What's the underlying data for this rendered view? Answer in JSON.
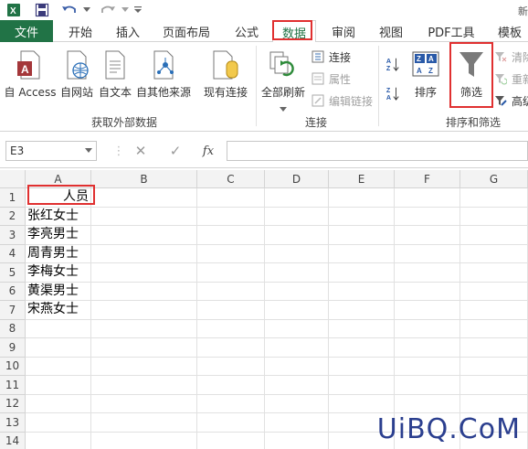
{
  "window": {
    "title": "新"
  },
  "quick_access": {
    "save_icon": "save-icon",
    "undo_icon": "undo-icon",
    "redo_icon": "redo-icon",
    "customize_icon": "customize-icon"
  },
  "tabs": {
    "file": "文件",
    "items": [
      "开始",
      "插入",
      "页面布局",
      "公式",
      "数据",
      "审阅",
      "视图",
      "PDF工具",
      "模板"
    ],
    "active": "数据"
  },
  "ribbon": {
    "get_external": {
      "label": "获取外部数据",
      "from_access": "自 Access",
      "from_web": "自网站",
      "from_text": "自文本",
      "from_other": "自其他来源",
      "existing": "现有连接"
    },
    "connections": {
      "label": "连接",
      "refresh_all": "全部刷新",
      "connections": "连接",
      "properties": "属性",
      "edit_links": "编辑链接"
    },
    "sort_filter": {
      "label": "排序和筛选",
      "sort": "排序",
      "filter": "筛选",
      "clear": "清除",
      "reapply": "重新",
      "advanced": "高级"
    }
  },
  "formula_bar": {
    "name_box": "E3",
    "cancel": "✕",
    "enter": "✓",
    "fx": "fx",
    "value": ""
  },
  "sheet": {
    "columns": [
      "A",
      "B",
      "C",
      "D",
      "E",
      "F",
      "G"
    ],
    "rows": [
      "1",
      "2",
      "3",
      "4",
      "5",
      "6",
      "7",
      "8",
      "9",
      "10",
      "11",
      "12",
      "13",
      "14"
    ],
    "cells": {
      "A1": "人员",
      "A2": "张红女士",
      "A3": "李亮男士",
      "A4": "周青男士",
      "A5": "李梅女士",
      "A6": "黄渠男士",
      "A7": "宋燕女士"
    }
  },
  "watermark": "UiBQ.CoM",
  "colors": {
    "excel_green": "#217346",
    "highlight_red": "#e03030"
  }
}
